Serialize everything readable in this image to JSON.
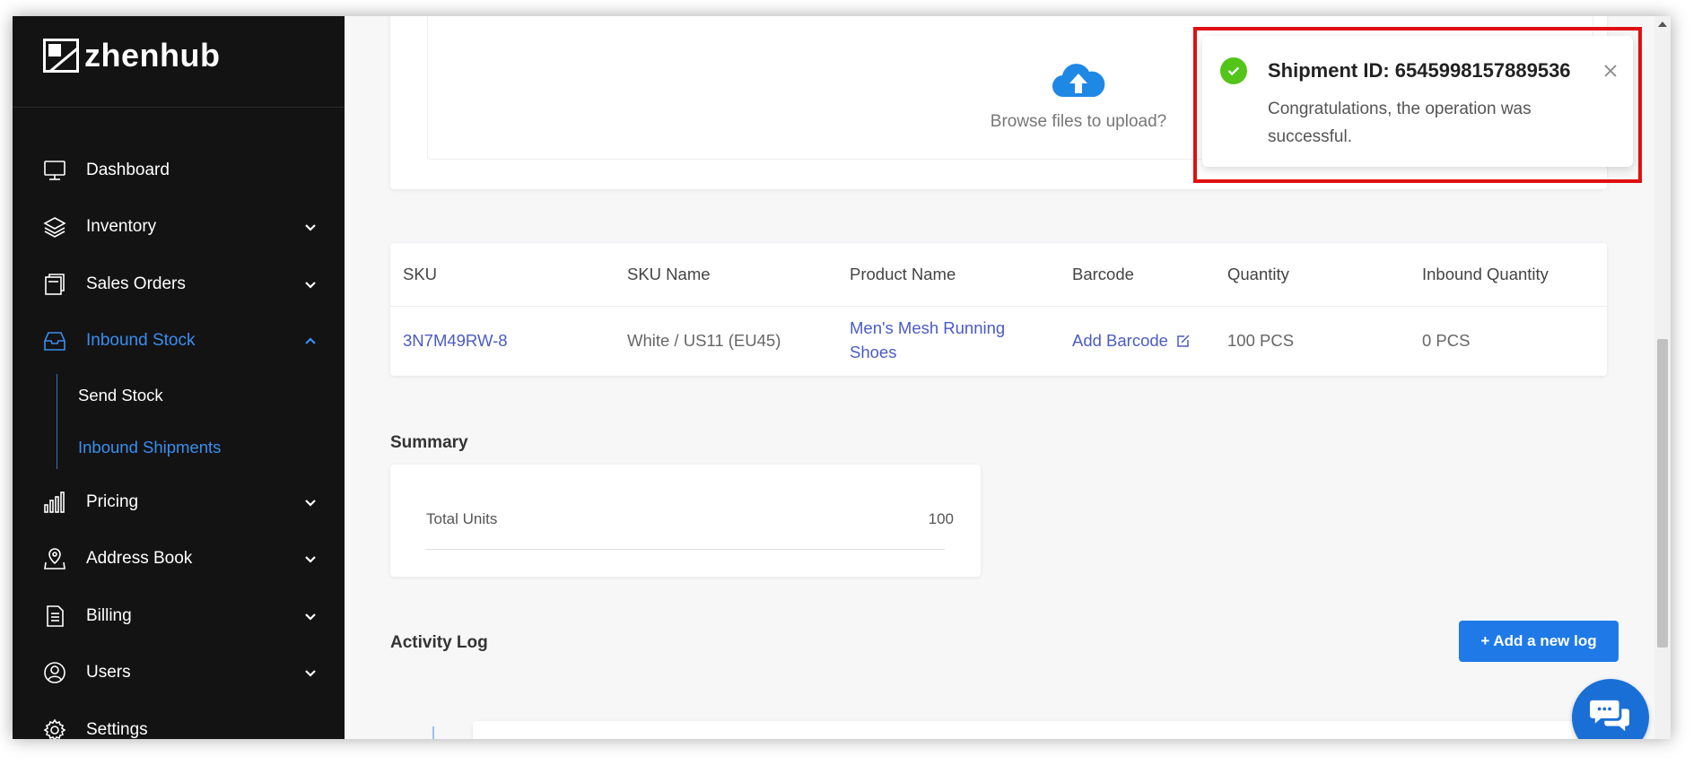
{
  "brand": {
    "name": "zhenhub"
  },
  "sidebar": {
    "items": [
      {
        "label": "Dashboard",
        "icon": "monitor-icon",
        "expandable": false
      },
      {
        "label": "Inventory",
        "icon": "layers-icon",
        "expandable": true
      },
      {
        "label": "Sales Orders",
        "icon": "folder-icon",
        "expandable": true
      },
      {
        "label": "Inbound Stock",
        "icon": "inbox-icon",
        "expandable": true,
        "active": true,
        "children": [
          {
            "label": "Send Stock"
          },
          {
            "label": "Inbound Shipments",
            "active": true
          }
        ]
      },
      {
        "label": "Pricing",
        "icon": "bar-chart-icon",
        "expandable": true
      },
      {
        "label": "Address Book",
        "icon": "map-pin-icon",
        "expandable": true
      },
      {
        "label": "Billing",
        "icon": "document-icon",
        "expandable": true
      },
      {
        "label": "Users",
        "icon": "user-icon",
        "expandable": true
      },
      {
        "label": "Settings",
        "icon": "gear-icon",
        "expandable": false
      }
    ]
  },
  "upload": {
    "text": "Browse files to upload?",
    "icon": "cloud-upload-icon"
  },
  "table": {
    "headers": [
      "SKU",
      "SKU Name",
      "Product Name",
      "Barcode",
      "Quantity",
      "Inbound Quantity"
    ],
    "rows": [
      {
        "sku": "3N7M49RW-8",
        "sku_name": "White / US11 (EU45)",
        "product_name_line1": "Men's Mesh Running",
        "product_name_line2": "Shoes",
        "barcode": "Add Barcode",
        "quantity": "100 PCS",
        "inbound_quantity": "0 PCS"
      }
    ]
  },
  "summary": {
    "title": "Summary",
    "total_units_label": "Total Units",
    "total_units_value": "100"
  },
  "activity": {
    "title": "Activity Log",
    "add_button": "+ Add a new log"
  },
  "toast": {
    "title": "Shipment ID: 6545998157889536",
    "message": "Congratulations, the operation was successful.",
    "status_color": "#52c41a",
    "highlight_color": "#e01010"
  },
  "colors": {
    "accent": "#3a8ef0",
    "link": "#4a5bc4",
    "button": "#1f7ae8",
    "sidebar_bg": "#131313"
  }
}
